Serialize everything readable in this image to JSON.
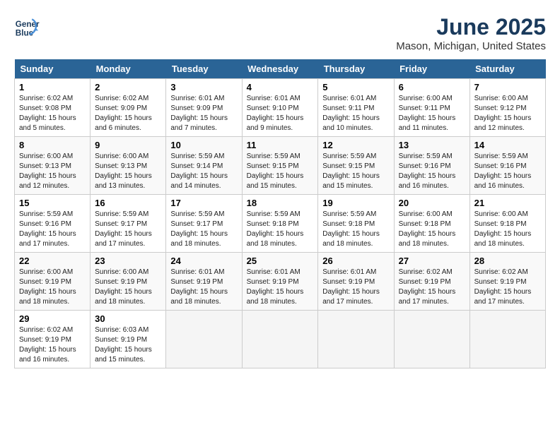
{
  "header": {
    "logo_line1": "General",
    "logo_line2": "Blue",
    "title": "June 2025",
    "subtitle": "Mason, Michigan, United States"
  },
  "days_of_week": [
    "Sunday",
    "Monday",
    "Tuesday",
    "Wednesday",
    "Thursday",
    "Friday",
    "Saturday"
  ],
  "weeks": [
    [
      {
        "day": "1",
        "sunrise": "6:02 AM",
        "sunset": "9:08 PM",
        "daylight": "15 hours and 5 minutes."
      },
      {
        "day": "2",
        "sunrise": "6:02 AM",
        "sunset": "9:09 PM",
        "daylight": "15 hours and 6 minutes."
      },
      {
        "day": "3",
        "sunrise": "6:01 AM",
        "sunset": "9:09 PM",
        "daylight": "15 hours and 7 minutes."
      },
      {
        "day": "4",
        "sunrise": "6:01 AM",
        "sunset": "9:10 PM",
        "daylight": "15 hours and 9 minutes."
      },
      {
        "day": "5",
        "sunrise": "6:01 AM",
        "sunset": "9:11 PM",
        "daylight": "15 hours and 10 minutes."
      },
      {
        "day": "6",
        "sunrise": "6:00 AM",
        "sunset": "9:11 PM",
        "daylight": "15 hours and 11 minutes."
      },
      {
        "day": "7",
        "sunrise": "6:00 AM",
        "sunset": "9:12 PM",
        "daylight": "15 hours and 12 minutes."
      }
    ],
    [
      {
        "day": "8",
        "sunrise": "6:00 AM",
        "sunset": "9:13 PM",
        "daylight": "15 hours and 12 minutes."
      },
      {
        "day": "9",
        "sunrise": "6:00 AM",
        "sunset": "9:13 PM",
        "daylight": "15 hours and 13 minutes."
      },
      {
        "day": "10",
        "sunrise": "5:59 AM",
        "sunset": "9:14 PM",
        "daylight": "15 hours and 14 minutes."
      },
      {
        "day": "11",
        "sunrise": "5:59 AM",
        "sunset": "9:15 PM",
        "daylight": "15 hours and 15 minutes."
      },
      {
        "day": "12",
        "sunrise": "5:59 AM",
        "sunset": "9:15 PM",
        "daylight": "15 hours and 15 minutes."
      },
      {
        "day": "13",
        "sunrise": "5:59 AM",
        "sunset": "9:16 PM",
        "daylight": "15 hours and 16 minutes."
      },
      {
        "day": "14",
        "sunrise": "5:59 AM",
        "sunset": "9:16 PM",
        "daylight": "15 hours and 16 minutes."
      }
    ],
    [
      {
        "day": "15",
        "sunrise": "5:59 AM",
        "sunset": "9:16 PM",
        "daylight": "15 hours and 17 minutes."
      },
      {
        "day": "16",
        "sunrise": "5:59 AM",
        "sunset": "9:17 PM",
        "daylight": "15 hours and 17 minutes."
      },
      {
        "day": "17",
        "sunrise": "5:59 AM",
        "sunset": "9:17 PM",
        "daylight": "15 hours and 18 minutes."
      },
      {
        "day": "18",
        "sunrise": "5:59 AM",
        "sunset": "9:18 PM",
        "daylight": "15 hours and 18 minutes."
      },
      {
        "day": "19",
        "sunrise": "5:59 AM",
        "sunset": "9:18 PM",
        "daylight": "15 hours and 18 minutes."
      },
      {
        "day": "20",
        "sunrise": "6:00 AM",
        "sunset": "9:18 PM",
        "daylight": "15 hours and 18 minutes."
      },
      {
        "day": "21",
        "sunrise": "6:00 AM",
        "sunset": "9:18 PM",
        "daylight": "15 hours and 18 minutes."
      }
    ],
    [
      {
        "day": "22",
        "sunrise": "6:00 AM",
        "sunset": "9:19 PM",
        "daylight": "15 hours and 18 minutes."
      },
      {
        "day": "23",
        "sunrise": "6:00 AM",
        "sunset": "9:19 PM",
        "daylight": "15 hours and 18 minutes."
      },
      {
        "day": "24",
        "sunrise": "6:01 AM",
        "sunset": "9:19 PM",
        "daylight": "15 hours and 18 minutes."
      },
      {
        "day": "25",
        "sunrise": "6:01 AM",
        "sunset": "9:19 PM",
        "daylight": "15 hours and 18 minutes."
      },
      {
        "day": "26",
        "sunrise": "6:01 AM",
        "sunset": "9:19 PM",
        "daylight": "15 hours and 17 minutes."
      },
      {
        "day": "27",
        "sunrise": "6:02 AM",
        "sunset": "9:19 PM",
        "daylight": "15 hours and 17 minutes."
      },
      {
        "day": "28",
        "sunrise": "6:02 AM",
        "sunset": "9:19 PM",
        "daylight": "15 hours and 17 minutes."
      }
    ],
    [
      {
        "day": "29",
        "sunrise": "6:02 AM",
        "sunset": "9:19 PM",
        "daylight": "15 hours and 16 minutes."
      },
      {
        "day": "30",
        "sunrise": "6:03 AM",
        "sunset": "9:19 PM",
        "daylight": "15 hours and 15 minutes."
      },
      null,
      null,
      null,
      null,
      null
    ]
  ]
}
